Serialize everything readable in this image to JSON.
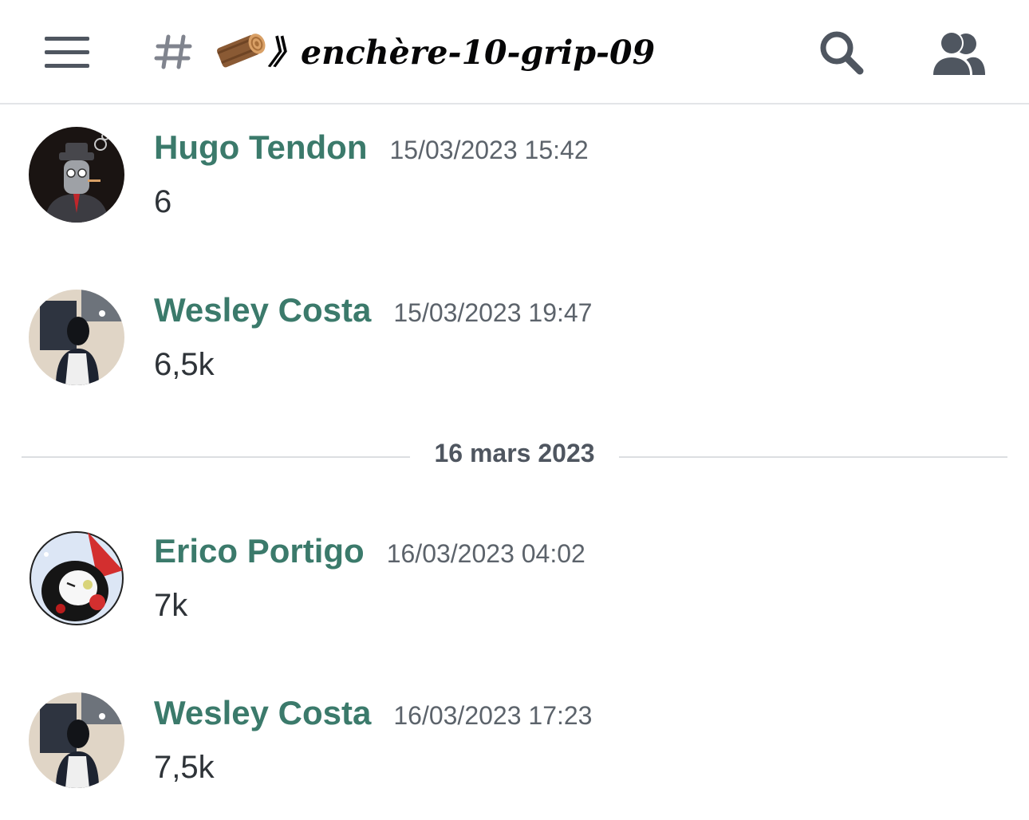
{
  "header": {
    "channel_prefix": "#",
    "channel_emoji": "log-emoji-icon",
    "channel_name": "》enchère-10-grip-09",
    "icons": [
      "hamburger-menu-icon",
      "hash-icon",
      "search-icon",
      "members-icon"
    ]
  },
  "messages": [
    {
      "author": "Hugo Tendon",
      "timestamp": "15/03/2023 15:42",
      "content": "6",
      "avatar": "smoking-robot-avatar"
    },
    {
      "author": "Wesley Costa",
      "timestamp": "15/03/2023 19:47",
      "content": "6,5k",
      "avatar": "masked-person-avatar"
    },
    {
      "author": "Erico Portigo",
      "timestamp": "16/03/2023 04:02",
      "content": "7k",
      "avatar": "anime-character-avatar"
    },
    {
      "author": "Wesley Costa",
      "timestamp": "16/03/2023 17:23",
      "content": "7,5k",
      "avatar": "masked-person-avatar"
    }
  ],
  "date_divider": "16 mars 2023",
  "colors": {
    "username": "#3b7a6b",
    "timestamp": "#5c636b",
    "text": "#2e3338",
    "icon": "#4f5660",
    "divider": "#dcdee1"
  }
}
